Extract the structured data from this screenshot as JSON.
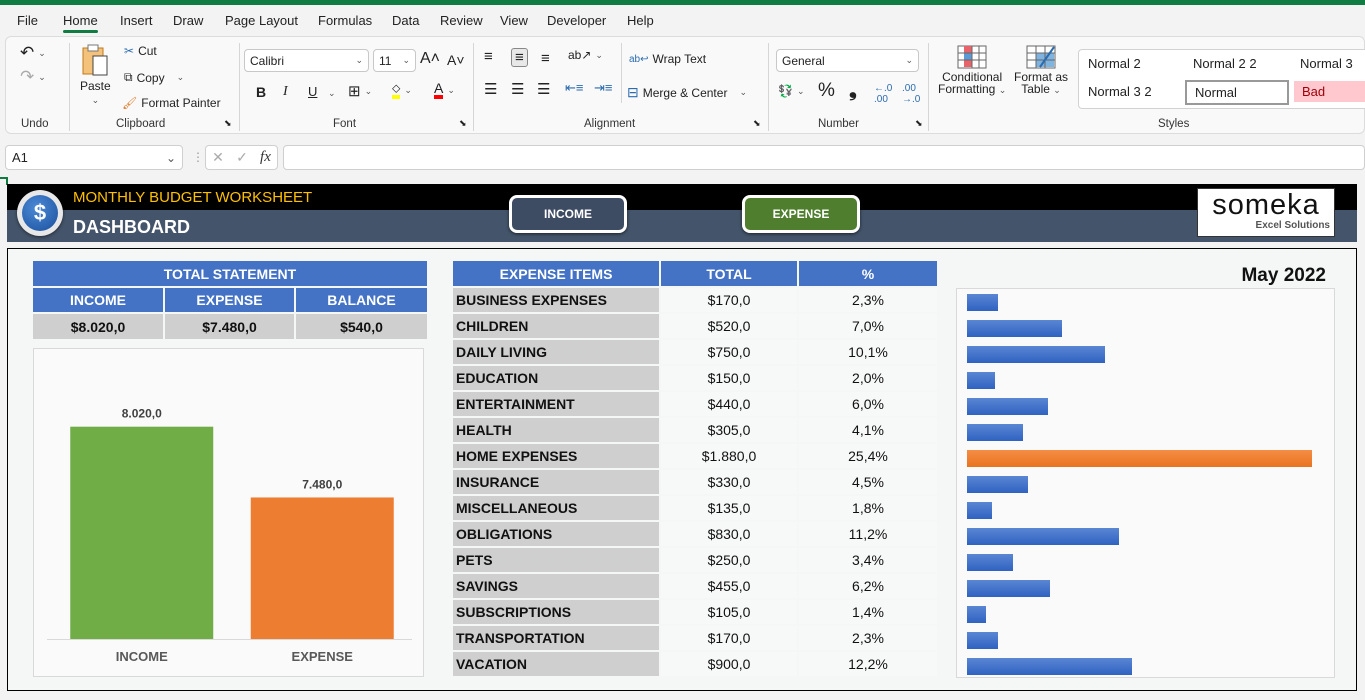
{
  "menu": {
    "tabs": [
      "File",
      "Home",
      "Insert",
      "Draw",
      "Page Layout",
      "Formulas",
      "Data",
      "Review",
      "View",
      "Developer",
      "Help"
    ],
    "active": "Home"
  },
  "ribbon": {
    "undo": {
      "group_label": "Undo"
    },
    "clipboard": {
      "paste": "Paste",
      "cut": "Cut",
      "copy": "Copy",
      "format_painter": "Format Painter",
      "group_label": "Clipboard"
    },
    "font": {
      "font_name": "Calibri",
      "font_size": "11",
      "bold": "B",
      "italic": "I",
      "underline": "U",
      "group_label": "Font",
      "highlight_color": "#ffff00",
      "font_color": "#ff0000"
    },
    "alignment": {
      "wrap_text": "Wrap Text",
      "merge_center": "Merge & Center",
      "group_label": "Alignment"
    },
    "number": {
      "format": "General",
      "percent": "%",
      "comma": "❟",
      "group_label": "Number"
    },
    "styles": {
      "conditional_formatting": [
        "Conditional",
        "Formatting"
      ],
      "format_as_table": [
        "Format as",
        "Table"
      ],
      "gallery": [
        "Normal 2",
        "Normal 2 2",
        "Normal 3",
        "Normal 3 2",
        "Normal",
        "Bad"
      ],
      "group_label": "Styles"
    }
  },
  "formula_bar": {
    "name_box": "A1",
    "fx": "fx",
    "formula": ""
  },
  "sheet": {
    "app_title": "MONTHLY BUDGET WORKSHEET",
    "page_title": "DASHBOARD",
    "nav_buttons": {
      "income": "INCOME",
      "expense": "EXPENSE"
    },
    "logo": {
      "brand": "someka",
      "tagline": "Excel Solutions"
    },
    "colors": {
      "header_blue": "#4472c4",
      "income_green": "#70ad47",
      "expense_orange": "#ed7d31",
      "nav_income_bg": "#3d4b63",
      "nav_expense_bg": "#4f7f2e",
      "title_gold": "#ffc000"
    },
    "total_statement": {
      "title": "TOTAL STATEMENT",
      "headers": [
        "INCOME",
        "EXPENSE",
        "BALANCE"
      ],
      "values": [
        "$8.020,0",
        "$7.480,0",
        "$540,0"
      ]
    },
    "expense_table": {
      "headers": [
        "EXPENSE ITEMS",
        "TOTAL",
        "%"
      ],
      "rows": [
        [
          "BUSINESS EXPENSES",
          "$170,0",
          "2,3%"
        ],
        [
          "CHILDREN",
          "$520,0",
          "7,0%"
        ],
        [
          "DAILY LIVING",
          "$750,0",
          "10,1%"
        ],
        [
          "EDUCATION",
          "$150,0",
          "2,0%"
        ],
        [
          "ENTERTAINMENT",
          "$440,0",
          "6,0%"
        ],
        [
          "HEALTH",
          "$305,0",
          "4,1%"
        ],
        [
          "HOME EXPENSES",
          "$1.880,0",
          "25,4%"
        ],
        [
          "INSURANCE",
          "$330,0",
          "4,5%"
        ],
        [
          "MISCELLANEOUS",
          "$135,0",
          "1,8%"
        ],
        [
          "OBLIGATIONS",
          "$830,0",
          "11,2%"
        ],
        [
          "PETS",
          "$250,0",
          "3,4%"
        ],
        [
          "SAVINGS",
          "$455,0",
          "6,2%"
        ],
        [
          "SUBSCRIPTIONS",
          "$105,0",
          "1,4%"
        ],
        [
          "TRANSPORTATION",
          "$170,0",
          "2,3%"
        ],
        [
          "VACATION",
          "$900,0",
          "12,2%"
        ]
      ]
    },
    "month_label": "May 2022"
  },
  "chart_data": [
    {
      "type": "bar",
      "title": "",
      "categories": [
        "INCOME",
        "EXPENSE"
      ],
      "values": [
        8020,
        7480
      ],
      "data_labels": [
        "8.020,0",
        "7.480,0"
      ],
      "colors": [
        "#70ad47",
        "#ed7d31"
      ],
      "ylim": [
        6400,
        8300
      ],
      "grid": false,
      "xlabel": "",
      "ylabel": ""
    },
    {
      "type": "bar",
      "orientation": "horizontal",
      "title": "",
      "categories": [
        "BUSINESS EXPENSES",
        "CHILDREN",
        "DAILY LIVING",
        "EDUCATION",
        "ENTERTAINMENT",
        "HEALTH",
        "HOME EXPENSES",
        "INSURANCE",
        "MISCELLANEOUS",
        "OBLIGATIONS",
        "PETS",
        "SAVINGS",
        "SUBSCRIPTIONS",
        "TRANSPORTATION",
        "VACATION"
      ],
      "values": [
        170,
        520,
        750,
        150,
        440,
        305,
        1880,
        330,
        135,
        830,
        250,
        455,
        105,
        170,
        900
      ],
      "highlight_max_color": "#ed7d31",
      "bar_color": "#4472c4",
      "xlim": [
        0,
        1880
      ],
      "grid": false
    }
  ]
}
